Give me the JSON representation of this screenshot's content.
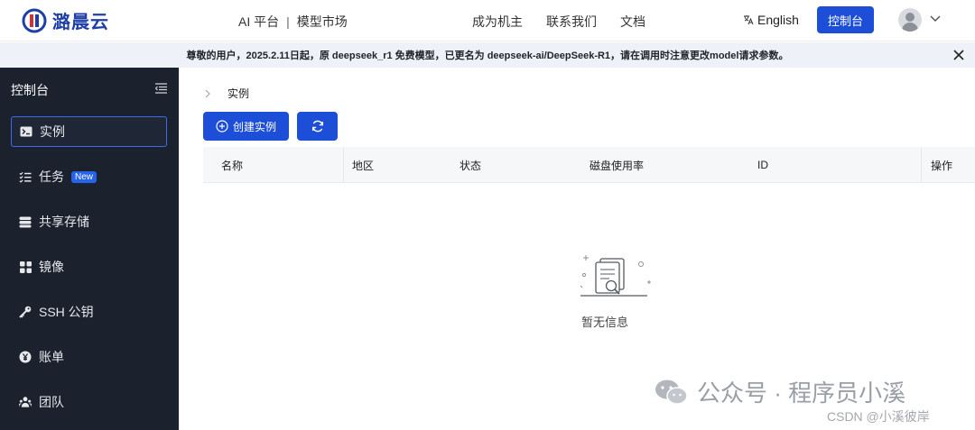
{
  "brand": {
    "name": "潞晨云",
    "color": "#1f3fa8"
  },
  "nav": {
    "platform": "AI 平台",
    "separator": "|",
    "market": "模型市场",
    "links": [
      "成为机主",
      "联系我们",
      "文档"
    ],
    "language": "English",
    "console_button": "控制台"
  },
  "notice": {
    "text": "尊敬的用户，2025.2.11日起，原 deepseek_r1 免费模型，已更名为 deepseek-ai/DeepSeek-R1，请在调用时注意更改model请求参数。"
  },
  "sidebar": {
    "title": "控制台",
    "items": [
      {
        "label": "实例",
        "icon": "terminal-icon",
        "active": true
      },
      {
        "label": "任务",
        "icon": "task-list-icon",
        "badge": "New"
      },
      {
        "label": "共享存储",
        "icon": "storage-icon"
      },
      {
        "label": "镜像",
        "icon": "image-grid-icon"
      },
      {
        "label": "SSH 公钥",
        "icon": "key-icon"
      },
      {
        "label": "账单",
        "icon": "yen-icon"
      },
      {
        "label": "团队",
        "icon": "team-icon"
      }
    ]
  },
  "main": {
    "breadcrumb": "实例",
    "create_button": "创建实例",
    "table": {
      "columns": [
        "名称",
        "地区",
        "状态",
        "磁盘使用率",
        "ID",
        "操作"
      ]
    },
    "empty_text": "暂无信息"
  },
  "watermark": {
    "line1": "公众号 · 程序员小溪",
    "line2": "CSDN @小溪彼岸"
  },
  "colors": {
    "accent": "#1d4ed8",
    "sidebar_bg": "#1b212d",
    "notice_bg": "#eef1f8"
  }
}
